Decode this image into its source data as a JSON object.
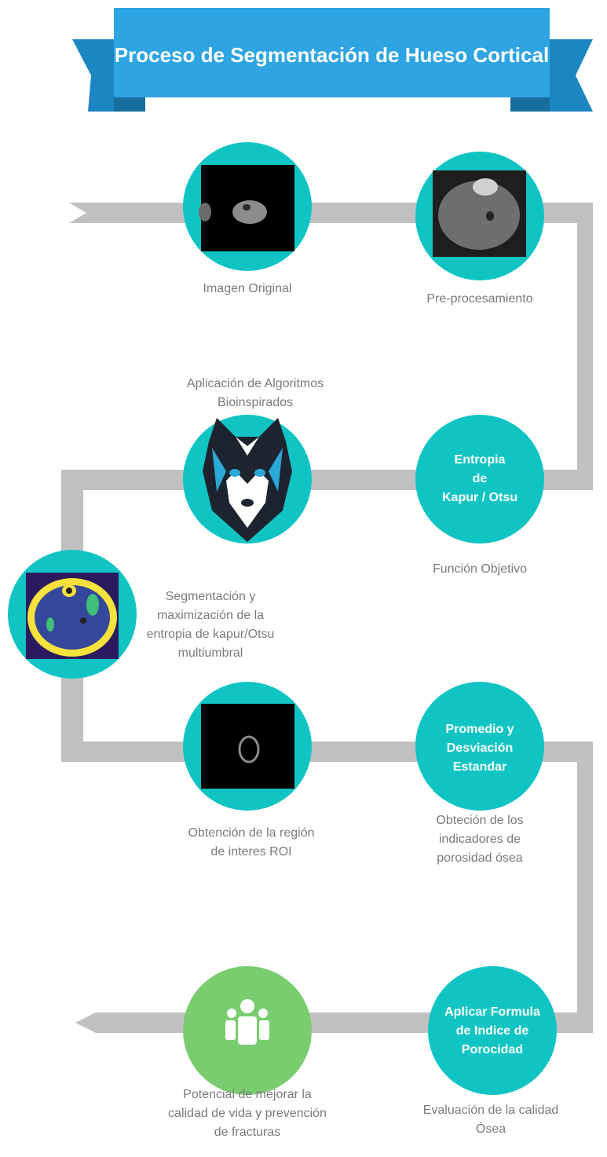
{
  "title": "Proceso de Segmentación de Hueso Cortical",
  "colors": {
    "banner": "#2ea4e2",
    "banner_fold": "#1b86c2",
    "circle": "#11c4c4",
    "circle_final": "#79cd6f",
    "path": "#c0c0c0",
    "label": "#7a7a7a"
  },
  "steps": [
    {
      "label": "Imagen Original",
      "content": "mri-scan-image"
    },
    {
      "label": "Pre-procesamiento",
      "content": "preprocessed-mri-image"
    },
    {
      "label": "Función Objetivo",
      "circle_text": [
        "Entropia",
        "de",
        "Kapur / Otsu"
      ]
    },
    {
      "label": [
        "Aplicación de Algoritmos",
        "Bioinspirados"
      ],
      "content": "wolf-icon"
    },
    {
      "label": [
        "Segmentación y",
        "maximización de la",
        "entropia de kapur/Otsu",
        "multiumbral"
      ],
      "content": "segmented-image"
    },
    {
      "label": [
        "Obtención de la región",
        "de interes ROI"
      ],
      "content": "roi-image"
    },
    {
      "label": [
        "Obteción de los",
        "indicadores de",
        "porosidad ósea"
      ],
      "circle_text": [
        "Promedio y",
        "Desviación",
        "Estandar"
      ]
    },
    {
      "label": [
        "Evaluación de la calidad",
        "Ósea"
      ],
      "circle_text": [
        "Aplicar Formula",
        "de Indice de",
        "Porocidad"
      ]
    },
    {
      "label": [
        "Potencial de mejorar la",
        "calidad de vida y prevención",
        "de fracturas"
      ],
      "content": "people-icon"
    }
  ]
}
